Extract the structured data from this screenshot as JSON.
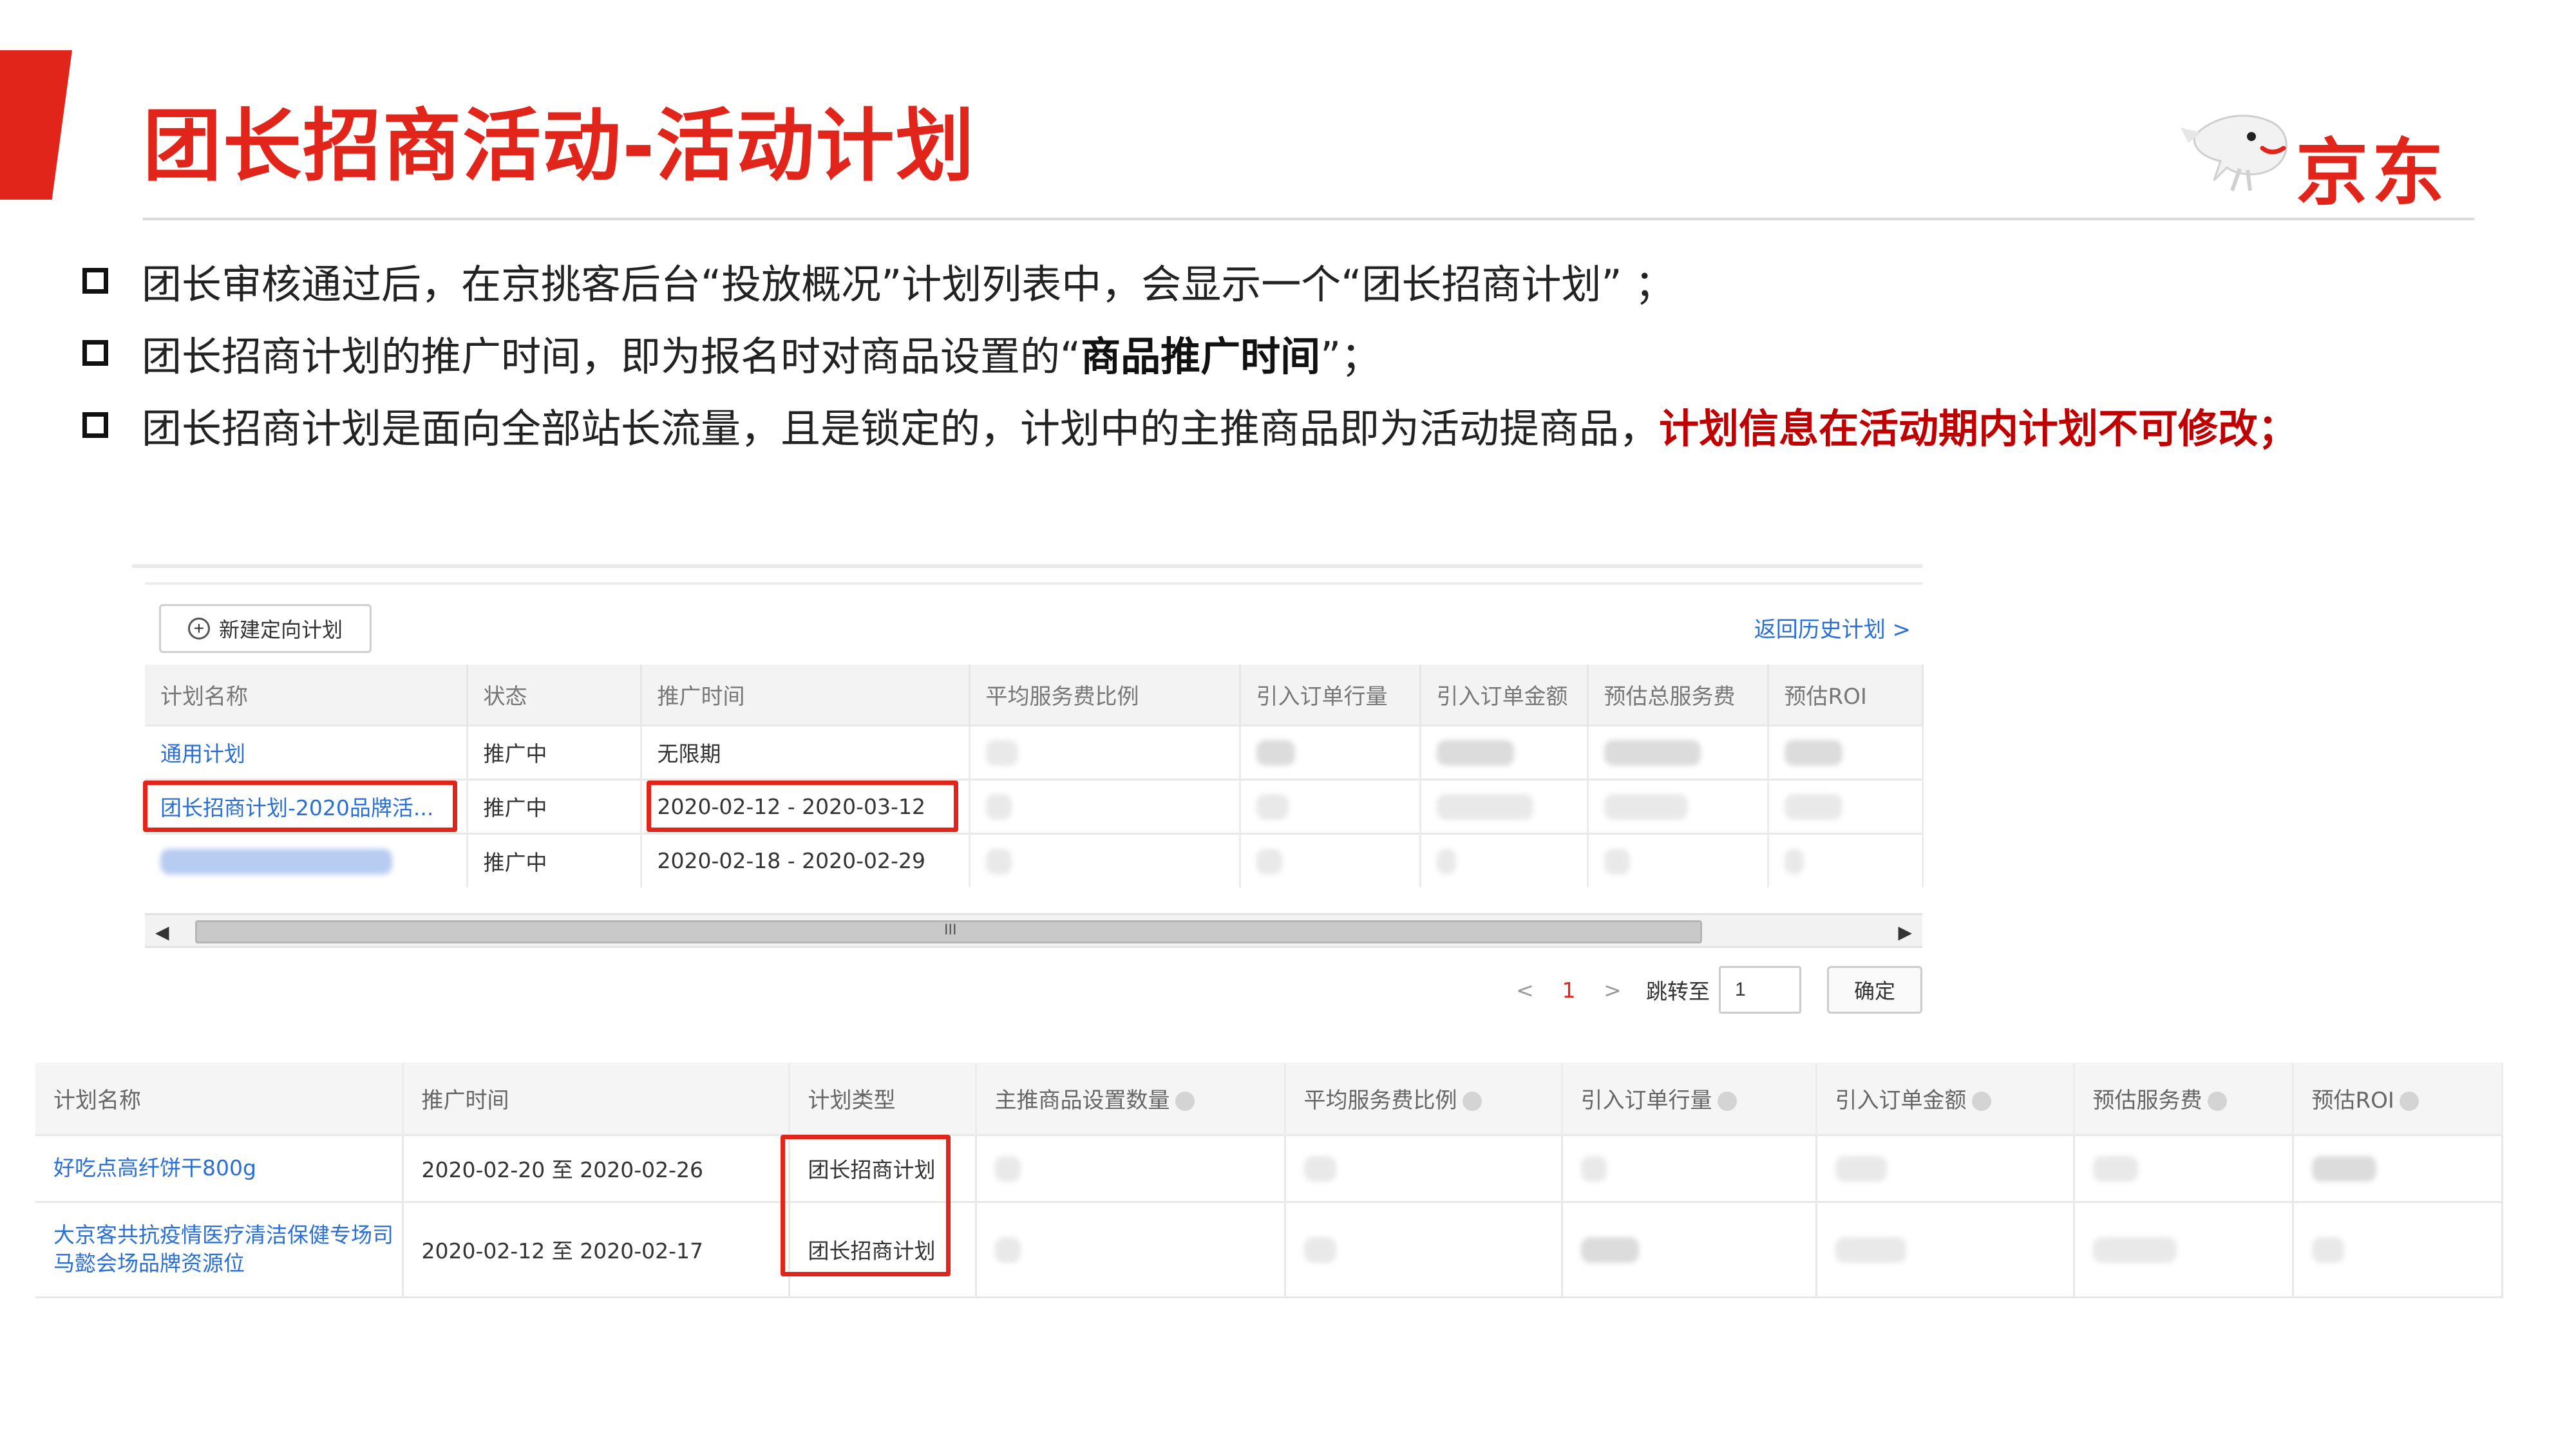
{
  "slide": {
    "title": "团长招商活动-活动计划",
    "brand": "京东",
    "accent_color": "#e1251b"
  },
  "bullets": [
    {
      "text": "团长审核通过后，在京挑客后台“投放概况”计划列表中，会显示一个“团长招商计划” ；"
    },
    {
      "pre": "团长招商计划的推广时间，即为报名时对商品设置的“",
      "strong": "商品推广时间",
      "post": "”；"
    },
    {
      "pre": "团长招商计划是面向全部站长流量，且是锁定的，计划中的主推商品即为活动提商品，",
      "red": "计划信息在活动期内计划不可修改；"
    }
  ],
  "plan_list": {
    "new_button": "新建定向计划",
    "history_link": "返回历史计划 >",
    "columns": [
      "计划名称",
      "状态",
      "推广时间",
      "平均服务费比例",
      "引入订单行量",
      "引入订单金额",
      "预估总服务费",
      "预估ROI"
    ],
    "rows": [
      {
        "name": "通用计划",
        "status": "推广中",
        "time": "无限期"
      },
      {
        "name": "团长招商计划-2020品牌活...",
        "status": "推广中",
        "time": "2020-02-12 - 2020-03-12"
      },
      {
        "name": "",
        "status": "推广中",
        "time": "2020-02-18 - 2020-02-29"
      }
    ],
    "scroll_grip": "III",
    "pager": {
      "prev": "<",
      "current": "1",
      "next": ">",
      "jump_label": "跳转至",
      "jump_value": "1",
      "confirm": "确定"
    }
  },
  "plan_detail": {
    "columns": [
      "计划名称",
      "推广时间",
      "计划类型",
      "主推商品设置数量",
      "平均服务费比例",
      "引入订单行量",
      "引入订单金额",
      "预估服务费",
      "预估ROI"
    ],
    "rows": [
      {
        "name": "好吃点高纤饼干800g",
        "time": "2020-02-20 至 2020-02-26",
        "type": "团长招商计划"
      },
      {
        "name": "大京客共抗疫情医疗清洁保健专场司马懿会场品牌资源位",
        "time": "2020-02-12 至 2020-02-17",
        "type": "团长招商计划"
      }
    ]
  }
}
